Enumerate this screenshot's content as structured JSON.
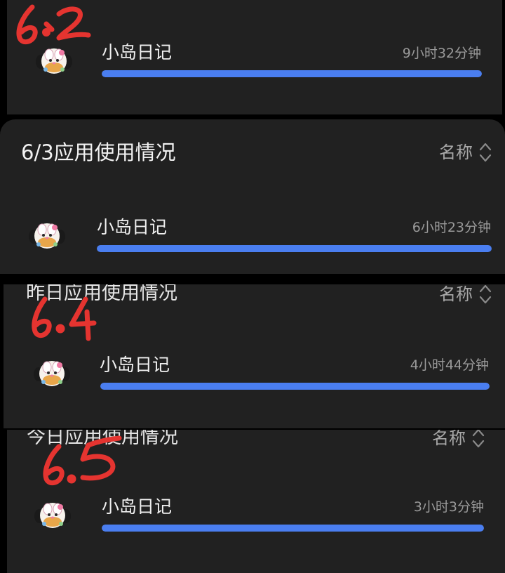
{
  "colors": {
    "bar": "#4a7ef0",
    "panel": "#212121",
    "annotation": "#e53430"
  },
  "sections": [
    {
      "title": "",
      "sort_label": "",
      "annotation": "6.2",
      "app": {
        "name": "小岛日记",
        "icon": "app-mascot-icon",
        "duration": "9小时32分钟",
        "usage_fraction": 1.0
      }
    },
    {
      "title": "6/3应用使用情况",
      "sort_label": "名称",
      "sort_icon": "sort-chevrons-icon",
      "annotation": "",
      "app": {
        "name": "小岛日记",
        "icon": "app-mascot-icon",
        "duration": "6小时23分钟",
        "usage_fraction": 1.0
      }
    },
    {
      "title": "昨日应用使用情况",
      "sort_label": "名称",
      "sort_icon": "sort-chevrons-icon",
      "annotation": "6.4",
      "app": {
        "name": "小岛日记",
        "icon": "app-mascot-icon",
        "duration": "4小时44分钟",
        "usage_fraction": 1.0
      }
    },
    {
      "title": "今日应用使用情况",
      "sort_label": "名称",
      "sort_icon": "sort-chevrons-icon",
      "annotation": "6.5",
      "app": {
        "name": "小岛日记",
        "icon": "app-mascot-icon",
        "duration": "3小时3分钟",
        "usage_fraction": 1.0
      }
    }
  ]
}
